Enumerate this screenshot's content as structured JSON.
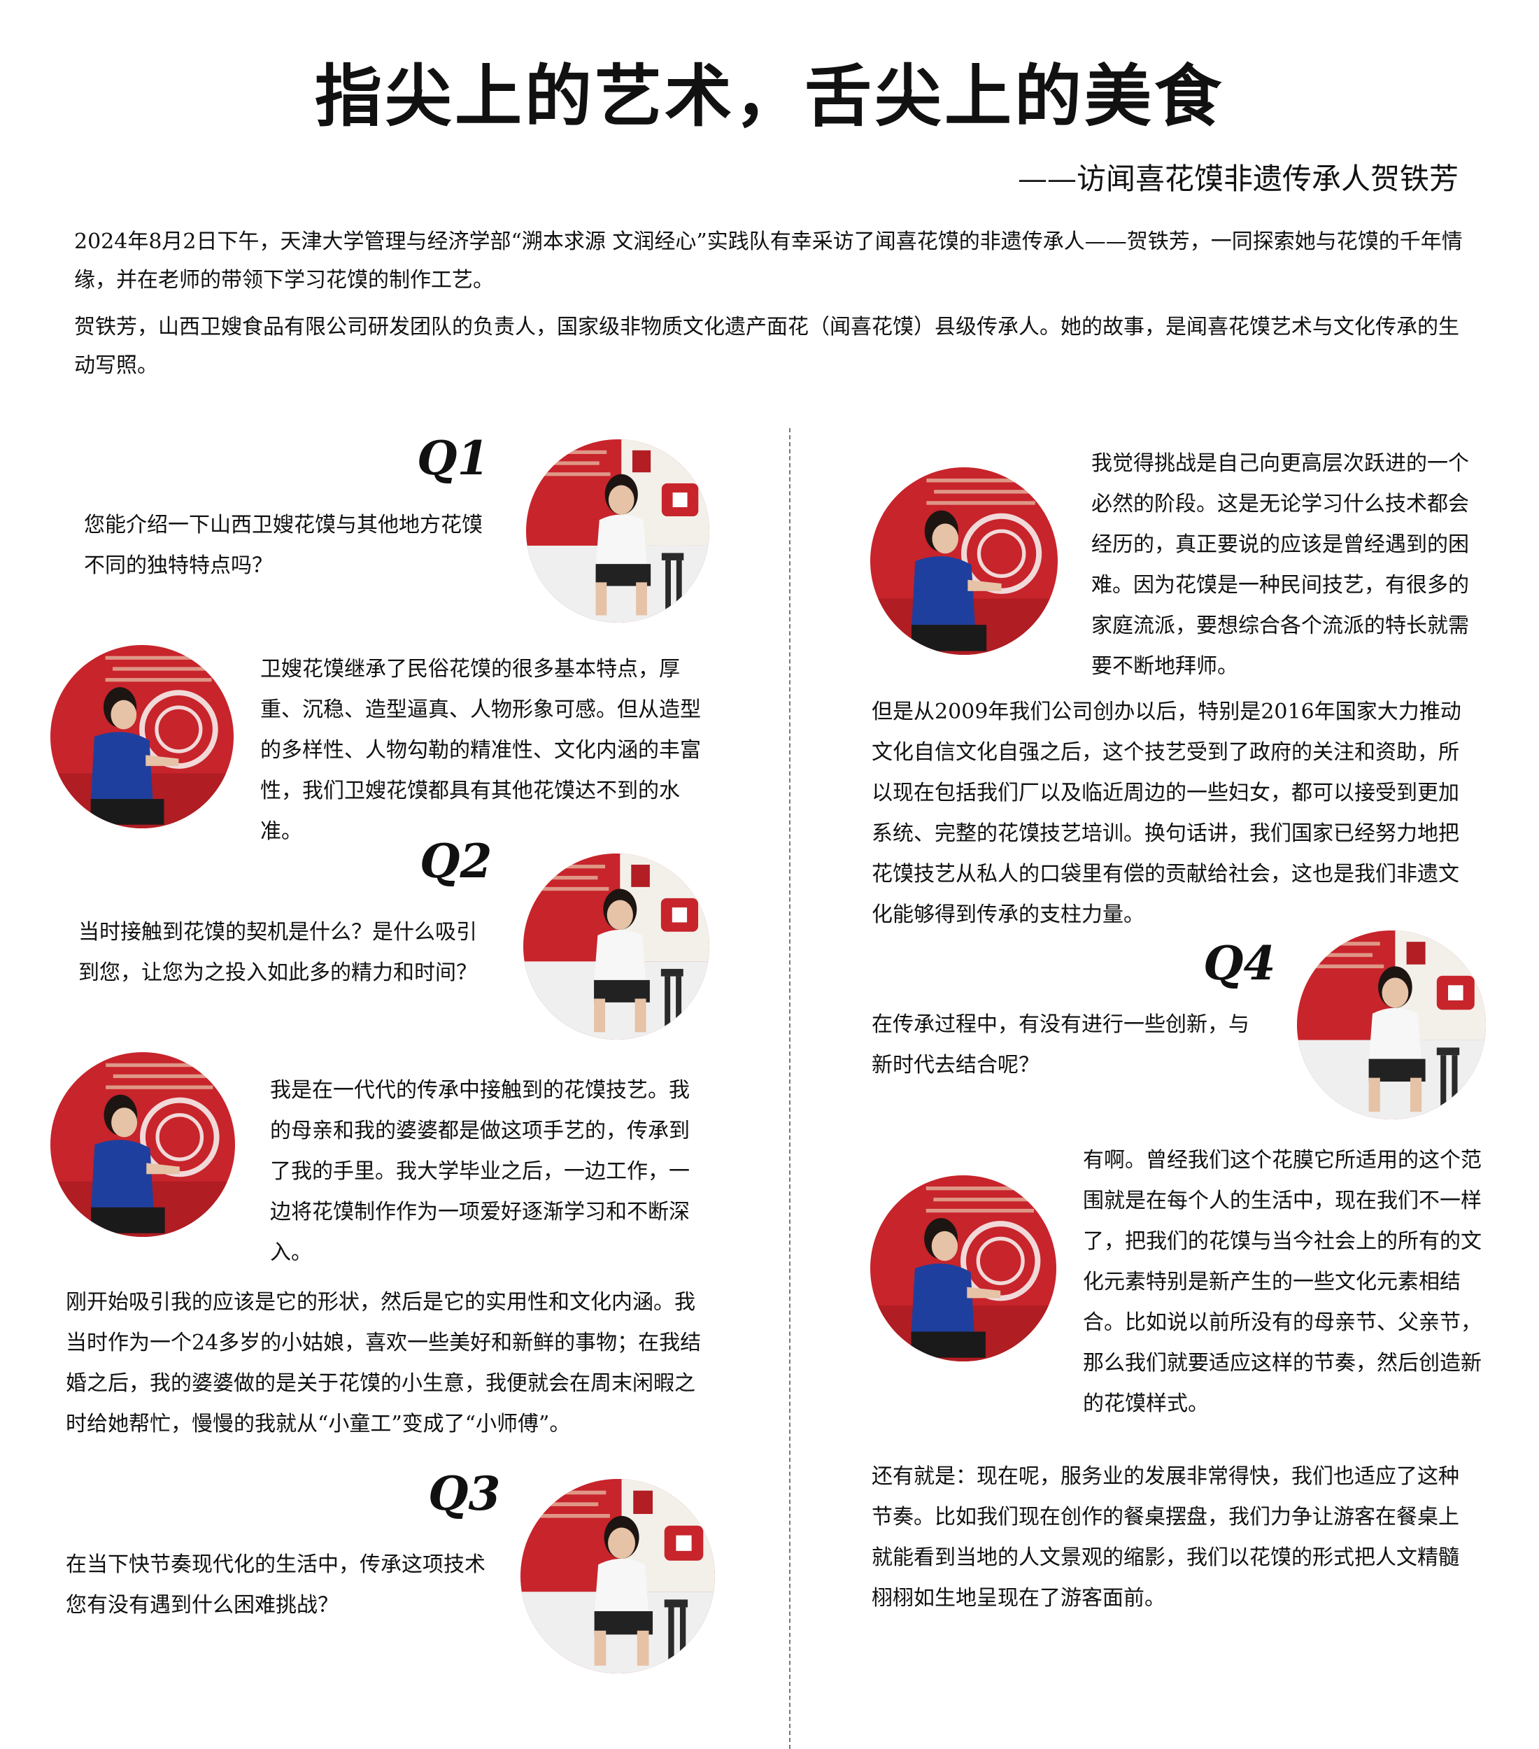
{
  "title": "指尖上的艺术，舌尖上的美食",
  "subtitle": "——访闻喜花馍非遗传承人贺铁芳",
  "intro": [
    "2024年8月2日下午，天津大学管理与经济学部“溯本求源 文润经心”实践队有幸采访了闻喜花馍的非遗传承人——贺铁芳，一同探索她与花馍的千年情缘，并在老师的带领下学习花馍的制作工艺。",
    "贺铁芳，山西卫嫂食品有限公司研发团队的负责人，国家级非物质文化遗产面花（闻喜花馍）县级传承人。她的故事，是闻喜花馍艺术与文化传承的生动写照。"
  ],
  "q1": {
    "label": "Q1",
    "question": "您能介绍一下山西卫嫂花馍与其他地方花馍不同的独特特点吗？",
    "answer": "卫嫂花馍继承了民俗花馍的很多基本特点，厚重、沉稳、造型逼真、人物形象可感。但从造型的多样性、人物勾勒的精准性、文化内涵的丰富性，我们卫嫂花馍都具有其他花馍达不到的水准。"
  },
  "q2": {
    "label": "Q2",
    "question": "当时接触到花馍的契机是什么？是什么吸引到您，让您为之投入如此多的精力和时间？",
    "answer1": "我是在一代代的传承中接触到的花馍技艺。我的母亲和我的婆婆都是做这项手艺的，传承到了我的手里。我大学毕业之后，一边工作，一边将花馍制作作为一项爱好逐渐学习和不断深入。",
    "answer2": "刚开始吸引我的应该是它的形状，然后是它的实用性和文化内涵。我当时作为一个24多岁的小姑娘，喜欢一些美好和新鲜的事物；在我结婚之后，我的婆婆做的是关于花馍的小生意，我便就会在周末闲暇之时给她帮忙，慢慢的我就从“小童工”变成了“小师傅”。"
  },
  "q3": {
    "label": "Q3",
    "question": "在当下快节奏现代化的生活中，传承这项技术您有没有遇到什么困难挑战？",
    "answer1": "我觉得挑战是自己向更高层次跃进的一个必然的阶段。这是无论学习什么技术都会经历的，真正要说的应该是曾经遇到的困难。因为花馍是一种民间技艺，有很多的家庭流派，要想综合各个流派的特长就需要不断地拜师。",
    "answer2": "但是从2009年我们公司创办以后，特别是2016年国家大力推动文化自信文化自强之后，这个技艺受到了政府的关注和资助，所以现在包括我们厂以及临近周边的一些妇女，都可以接受到更加系统、完整的花馍技艺培训。换句话讲，我们国家已经努力地把花馍技艺从私人的口袋里有偿的贡献给社会，这也是我们非遗文化能够得到传承的支柱力量。"
  },
  "q4": {
    "label": "Q4",
    "question": "在传承过程中，有没有进行一些创新，与新时代去结合呢？",
    "answer1": "有啊。曾经我们这个花膜它所适用的这个范围就是在每个人的生活中，现在我们不一样了，把我们的花馍与当今社会上的所有的文化元素特别是新产生的一些文化元素相结合。比如说以前所没有的母亲节、父亲节，那么我们就要适应这样的节奏，然后创造新的花馍样式。",
    "answer2": "还有就是：现在呢，服务业的发展非常得快，我们也适应了这种节奏。比如我们现在创作的餐桌摆盘，我们力争让游客在餐桌上就能看到当地的人文景观的缩影，我们以花馍的形式把人文精髓栩栩如生地呈现在了游客面前。"
  },
  "photos": {
    "interviewer": "student-interviewer-photo",
    "interviewee": "inheritor-he-tiefang-photo"
  }
}
